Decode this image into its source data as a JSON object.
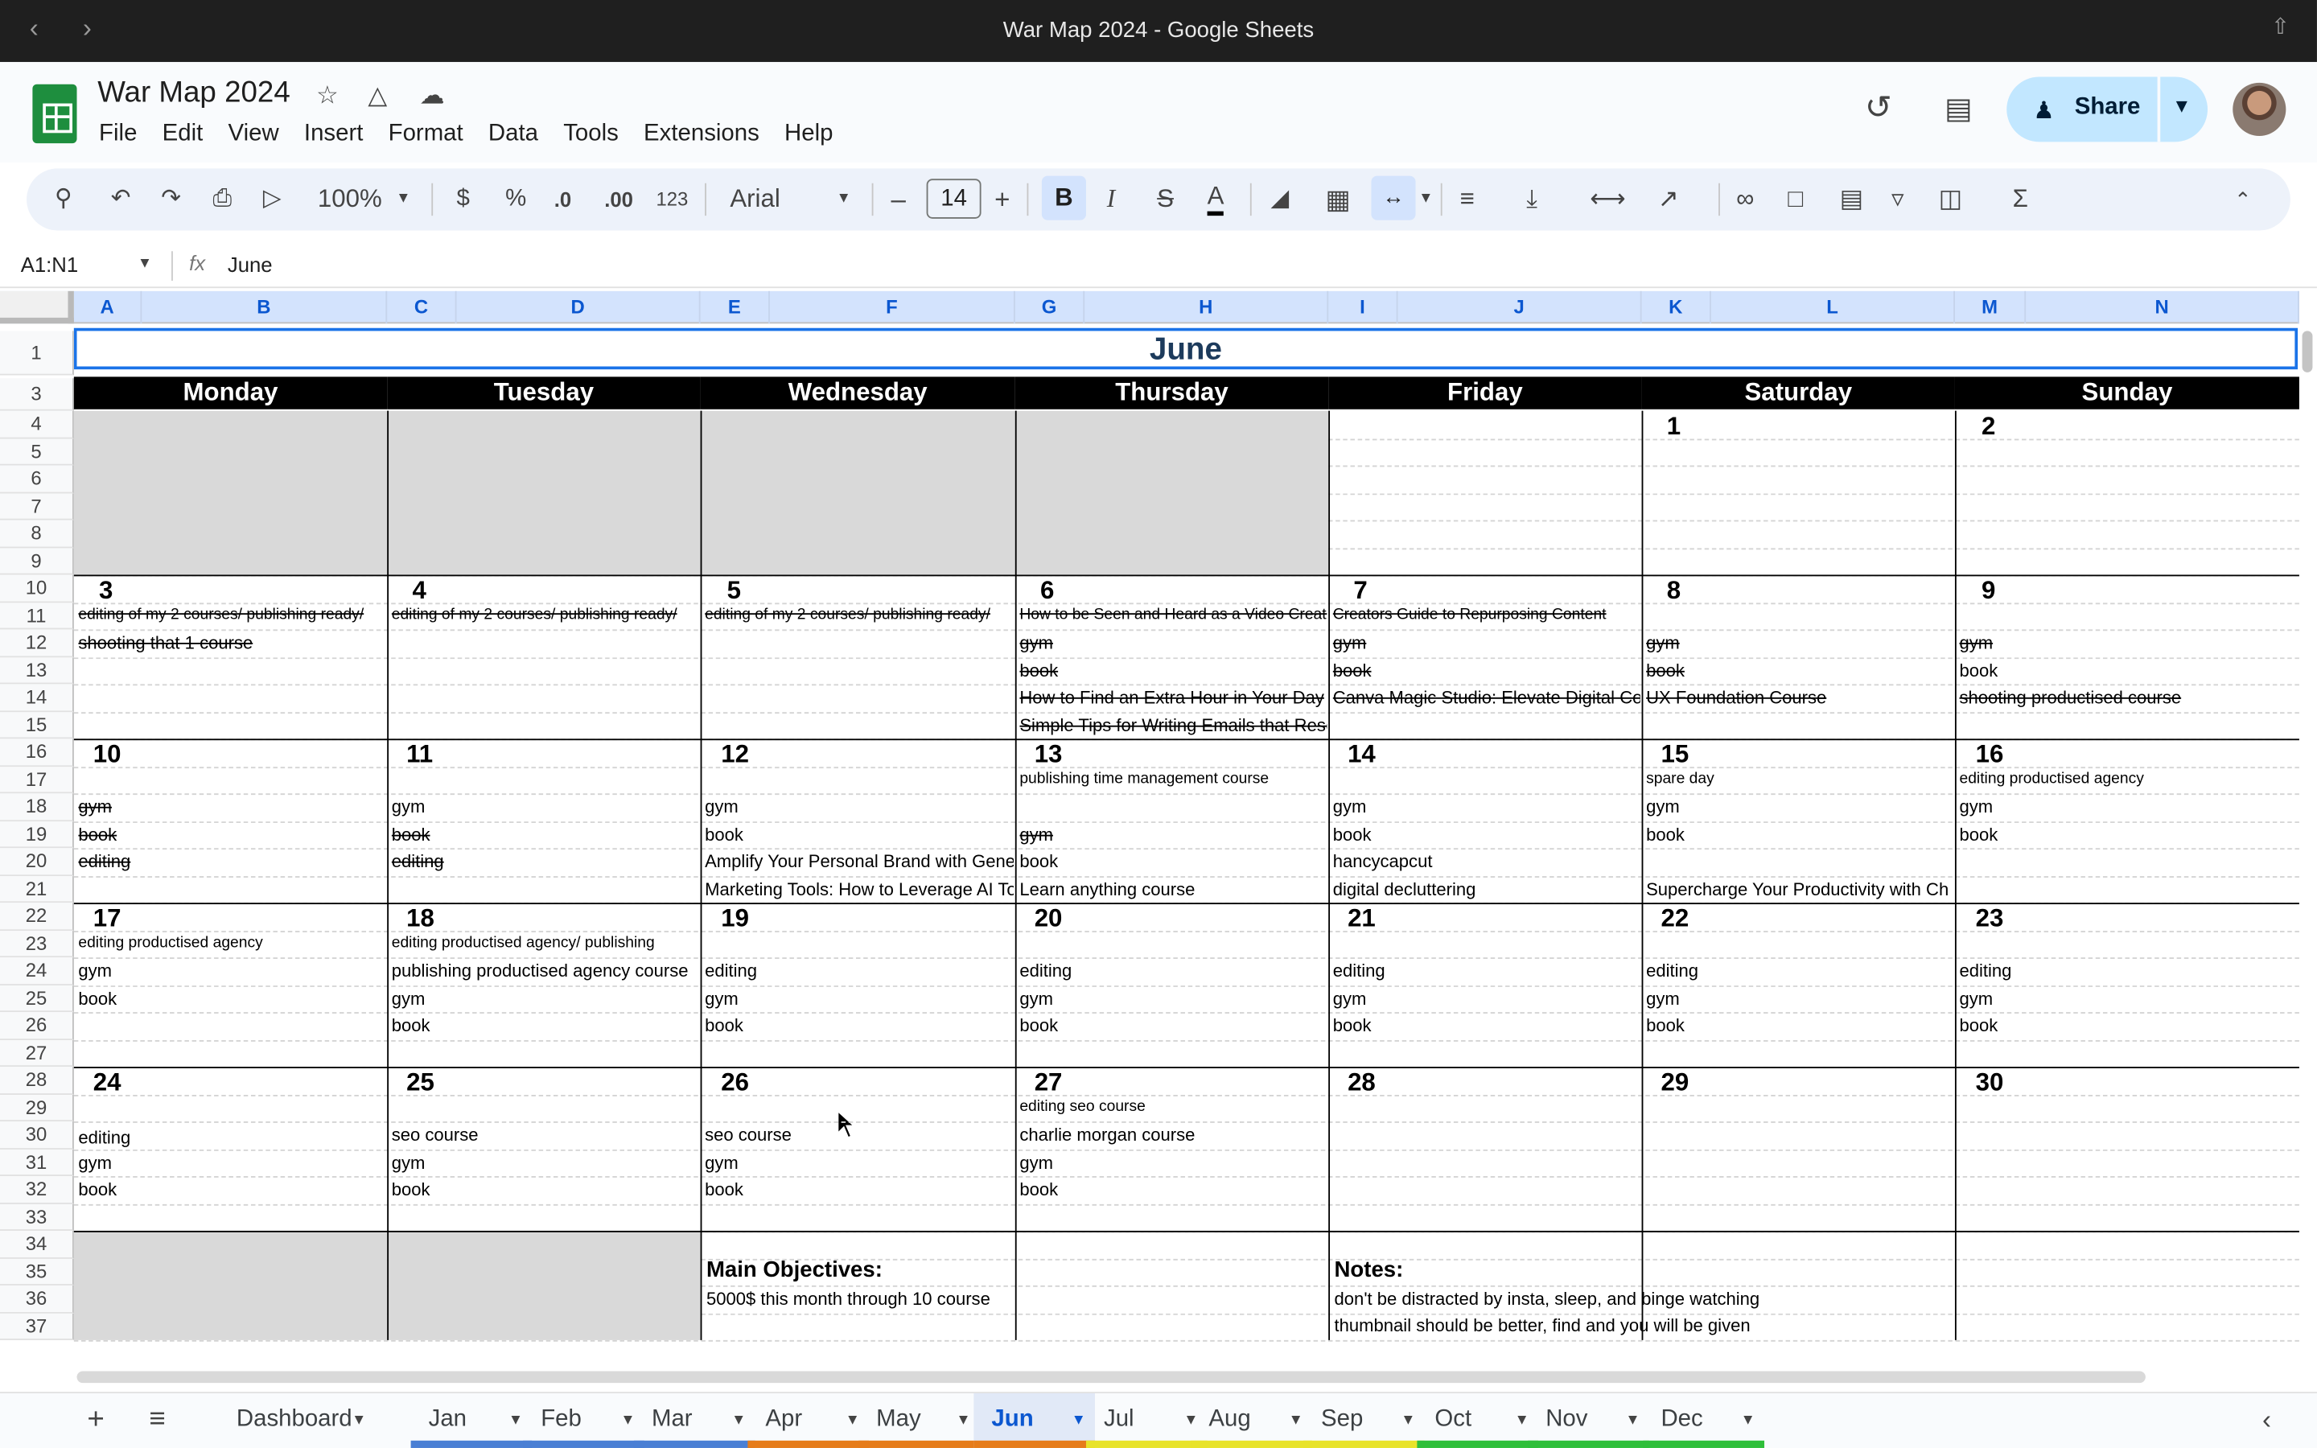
{
  "window": {
    "title": "War Map 2024 - Google Sheets"
  },
  "doc": {
    "title": "War Map 2024"
  },
  "menu": [
    "File",
    "Edit",
    "View",
    "Insert",
    "Format",
    "Data",
    "Tools",
    "Extensions",
    "Help"
  ],
  "share": {
    "label": "Share"
  },
  "toolbar": {
    "zoom": "100%",
    "currency": "$",
    "percent": "%",
    "dec_less": ".0",
    "dec_more": ".00",
    "num_format": "123",
    "font": "Arial",
    "font_size": "14",
    "bold": "B",
    "italic": "I",
    "strike": "S",
    "text_color": "A",
    "sigma": "Σ"
  },
  "formula": {
    "namebox": "A1:N1",
    "fx": "fx",
    "value": "June"
  },
  "columns": [
    "A",
    "B",
    "C",
    "D",
    "E",
    "F",
    "G",
    "H",
    "I",
    "J",
    "K",
    "L",
    "M",
    "N"
  ],
  "rows": [
    "1",
    "3",
    "4",
    "5",
    "6",
    "7",
    "8",
    "9",
    "10",
    "11",
    "12",
    "13",
    "14",
    "15",
    "16",
    "17",
    "18",
    "19",
    "20",
    "21",
    "22",
    "23",
    "24",
    "25",
    "26",
    "27",
    "28",
    "29",
    "30",
    "31",
    "32",
    "33",
    "34",
    "35",
    "36",
    "37"
  ],
  "calendar": {
    "month": "June",
    "weekdays": [
      "Monday",
      "Tuesday",
      "Wednesday",
      "Thursday",
      "Friday",
      "Saturday",
      "Sunday"
    ],
    "days": [
      "1",
      "2",
      "3",
      "4",
      "5",
      "6",
      "7",
      "8",
      "9",
      "10",
      "11",
      "12",
      "13",
      "14",
      "15",
      "16",
      "17",
      "18",
      "19",
      "20",
      "21",
      "22",
      "23",
      "24",
      "25",
      "26",
      "27",
      "28",
      "29",
      "30"
    ],
    "entries": [
      "editing of my 2 courses/ publishing ready/",
      "shooting that 1 course",
      "editing of my 2 courses/ publishing ready/",
      "editing of my 2 courses/ publishing ready/",
      "How to be Seen and Heard as a Video Creator",
      "gym",
      "book",
      "How to Find an Extra Hour in Your Day",
      "Simple Tips for Writing Emails that Reso",
      "Creators Guide to Repurposing Content",
      "gym",
      "book",
      "Canva Magic Studio: Elevate Digital Con",
      "gym",
      "book",
      "UX Foundation Course",
      "gym",
      "book",
      "shooting productised course",
      "gym",
      "book",
      "editing",
      "gym",
      "book",
      "editing",
      "gym",
      "book",
      "Amplify Your Personal Brand with Gener",
      "Marketing Tools: How to Leverage AI Too",
      "publishing time management course",
      "gym",
      "book",
      "Learn anything course",
      "gym",
      "book",
      "hancycapcut",
      "digital decluttering",
      "spare day",
      "gym",
      "book",
      "Supercharge Your Productivity with Chat",
      "editing productised agency",
      "gym",
      "book",
      "editing productised agency",
      "gym",
      "book",
      "editing productised agency/ publishing",
      "publishing productised agency course",
      "gym",
      "book",
      "editing",
      "gym",
      "book",
      "editing",
      "gym",
      "book",
      "editing",
      "gym",
      "book",
      "editing",
      "gym",
      "book",
      "editing",
      "gym",
      "book",
      "editing",
      "gym",
      "book",
      "seo course",
      "gym",
      "book",
      "seo course",
      "gym",
      "book",
      "editing seo course",
      "charlie morgan course",
      "gym",
      "book"
    ],
    "objectives_title": "Main Objectives:",
    "objectives": [
      "5000$ this month through 10 course"
    ],
    "notes_title": "Notes:",
    "notes": [
      "don't be distracted by insta, sleep, and binge watching",
      "thumbnail should be better, find and you will be given"
    ]
  },
  "sheets": [
    "Dashboard",
    "Jan",
    "Feb",
    "Mar",
    "Apr",
    "May",
    "Jun",
    "Jul",
    "Aug",
    "Sep",
    "Oct",
    "Nov",
    "Dec"
  ],
  "active_sheet": "Jun",
  "colors": {
    "accent": "#0b57d0",
    "share_bg": "#c2e7ff",
    "header_black": "#000000",
    "empty_cell": "#d9d9d9"
  }
}
